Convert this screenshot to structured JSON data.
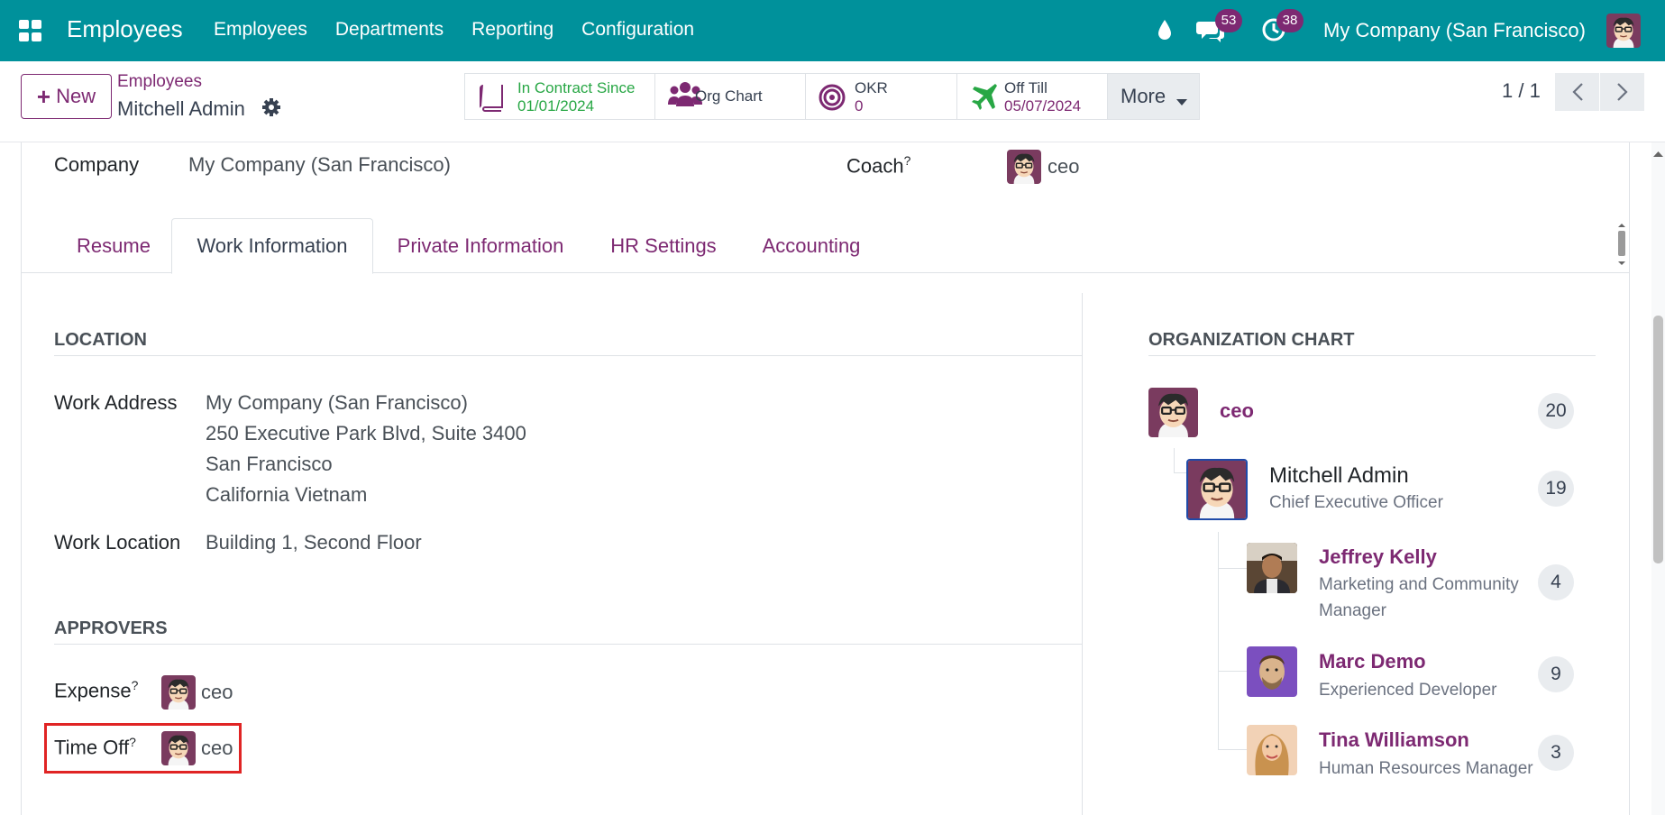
{
  "navbar": {
    "app_name": "Employees",
    "menu": [
      "Employees",
      "Departments",
      "Reporting",
      "Configuration"
    ],
    "messages_count": "53",
    "activities_count": "38",
    "company": "My Company (San Francisco)",
    "accent_color": "#00919b",
    "icons": [
      "apps-icon",
      "drop-icon",
      "chat-icon",
      "clock-icon"
    ]
  },
  "control": {
    "new_label": "New",
    "breadcrumb_parent": "Employees",
    "breadcrumb_current": "Mitchell Admin",
    "smart_buttons": {
      "contract": {
        "label": "In Contract Since",
        "value": "01/01/2024"
      },
      "org": {
        "label": "Org Chart"
      },
      "okr": {
        "label": "OKR",
        "value": "0"
      },
      "off": {
        "label": "Off Till",
        "value": "05/07/2024"
      },
      "more": {
        "label": "More"
      }
    },
    "pager": "1 / 1"
  },
  "form": {
    "company_label": "Company",
    "company_value": "My Company (San Francisco)",
    "coach_label": "Coach",
    "coach_value": "ceo",
    "help_mark": "?",
    "tabs": [
      "Resume",
      "Work Information",
      "Private Information",
      "HR Settings",
      "Accounting"
    ],
    "active_tab": "Work Information",
    "location": {
      "title": "LOCATION",
      "work_address_label": "Work Address",
      "address_lines": [
        "My Company (San Francisco)",
        "250 Executive Park Blvd, Suite 3400",
        "San Francisco",
        "California Vietnam"
      ],
      "work_location_label": "Work Location",
      "work_location_value": "Building 1, Second Floor"
    },
    "approvers": {
      "title": "APPROVERS",
      "expense_label": "Expense",
      "expense_value": "ceo",
      "timeoff_label": "Time Off",
      "timeoff_value": "ceo"
    }
  },
  "org_chart": {
    "title": "ORGANIZATION CHART",
    "manager": {
      "name": "ceo",
      "count": "20"
    },
    "self": {
      "name": "Mitchell Admin",
      "title": "Chief Executive Officer",
      "count": "19"
    },
    "subordinates": [
      {
        "name": "Jeffrey Kelly",
        "title_l1": "Marketing and Community",
        "title_l2": "Manager",
        "count": "4"
      },
      {
        "name": "Marc Demo",
        "title_l1": "Experienced Developer",
        "count": "9"
      },
      {
        "name": "Tina Williamson",
        "title_l1": "Human Resources Manager",
        "count": "3"
      }
    ]
  }
}
